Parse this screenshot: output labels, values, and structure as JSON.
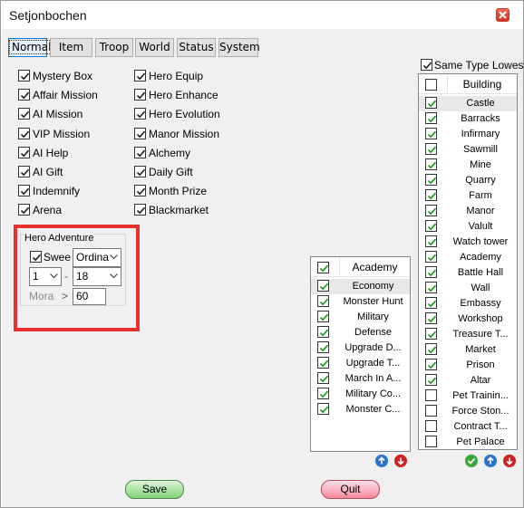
{
  "window": {
    "title": "Setjonbochen"
  },
  "tabs": [
    "Normal",
    "Item",
    "Troop",
    "World",
    "Status",
    "System"
  ],
  "active_tab": "Normal",
  "options_left": [
    {
      "label": "Mystery Box",
      "checked": true
    },
    {
      "label": "Affair Mission",
      "checked": true
    },
    {
      "label": "AI Mission",
      "checked": true
    },
    {
      "label": "VIP Mission",
      "checked": true
    },
    {
      "label": "AI Help",
      "checked": true
    },
    {
      "label": "AI Gift",
      "checked": true
    },
    {
      "label": "Indemnify",
      "checked": true
    },
    {
      "label": "Arena",
      "checked": true
    }
  ],
  "options_right": [
    {
      "label": "Hero Equip",
      "checked": true
    },
    {
      "label": "Hero Enhance",
      "checked": true
    },
    {
      "label": "Hero Evolution",
      "checked": true
    },
    {
      "label": "Manor Mission",
      "checked": true
    },
    {
      "label": "Alchemy",
      "checked": true
    },
    {
      "label": "Daily Gift",
      "checked": true
    },
    {
      "label": "Month Prize",
      "checked": true
    },
    {
      "label": "Blackmarket",
      "checked": true
    }
  ],
  "hero_adventure": {
    "title": "Hero Adventure",
    "sweep_label": "Sweep",
    "sweep_checked": true,
    "mode_value": "Ordina",
    "range_from": "1",
    "range_sep": "-",
    "range_to": "18",
    "morale_label": "Morale",
    "morale_op": ">",
    "morale_value": "60"
  },
  "academy_list": {
    "header": "Academy",
    "header_checked": true,
    "items": [
      {
        "label": "Economy",
        "checked": true,
        "selected": true
      },
      {
        "label": "Monster Hunt",
        "checked": true
      },
      {
        "label": "Military",
        "checked": true
      },
      {
        "label": "Defense",
        "checked": true
      },
      {
        "label": "Upgrade D...",
        "checked": true
      },
      {
        "label": "Upgrade T...",
        "checked": true
      },
      {
        "label": "March In A...",
        "checked": true
      },
      {
        "label": "Military Co...",
        "checked": true
      },
      {
        "label": "Monster C...",
        "checked": true
      }
    ]
  },
  "same_type_lowest": {
    "label": "Same Type Lowest",
    "checked": true
  },
  "building_list": {
    "header": "Building",
    "header_checked": false,
    "items": [
      {
        "label": "Castle",
        "checked": true,
        "selected": true
      },
      {
        "label": "Barracks",
        "checked": true
      },
      {
        "label": "Infirmary",
        "checked": true
      },
      {
        "label": "Sawmill",
        "checked": true
      },
      {
        "label": "Mine",
        "checked": true
      },
      {
        "label": "Quarry",
        "checked": true
      },
      {
        "label": "Farm",
        "checked": true
      },
      {
        "label": "Manor",
        "checked": true
      },
      {
        "label": "Valult",
        "checked": true
      },
      {
        "label": "Watch tower",
        "checked": true
      },
      {
        "label": "Academy",
        "checked": true
      },
      {
        "label": "Battle Hall",
        "checked": true
      },
      {
        "label": "Wall",
        "checked": true
      },
      {
        "label": "Embassy",
        "checked": true
      },
      {
        "label": "Workshop",
        "checked": true
      },
      {
        "label": "Treasure T...",
        "checked": true
      },
      {
        "label": "Market",
        "checked": true
      },
      {
        "label": "Prison",
        "checked": true
      },
      {
        "label": "Altar",
        "checked": true
      },
      {
        "label": "Pet Trainin...",
        "checked": false
      },
      {
        "label": "Force Ston...",
        "checked": false
      },
      {
        "label": "Contract T...",
        "checked": false
      },
      {
        "label": "Pet Palace",
        "checked": false
      }
    ]
  },
  "buttons": {
    "save": "Save",
    "quit": "Quit"
  },
  "colors": {
    "highlight": "#e8302f",
    "check": "#1a9a1a",
    "up": "#2a72c8",
    "down": "#d02020",
    "confirm": "#3aa83a"
  }
}
